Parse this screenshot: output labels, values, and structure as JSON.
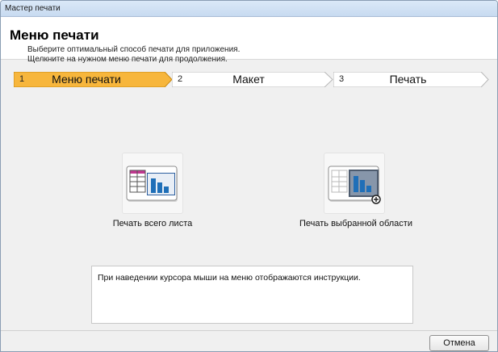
{
  "window": {
    "title": "Мастер печати"
  },
  "header": {
    "title": "Меню печати",
    "subtitle_line1": "Выберите оптимальный способ печати для приложения.",
    "subtitle_line2": "Щелкните на нужном меню печати для продолжения."
  },
  "steps": [
    {
      "number": "1",
      "label": "Меню печати",
      "active": true
    },
    {
      "number": "2",
      "label": "Макет",
      "active": false
    },
    {
      "number": "3",
      "label": "Печать",
      "active": false
    }
  ],
  "options": [
    {
      "label": "Печать всего листа",
      "icon": "sheet-with-chart-icon"
    },
    {
      "label": "Печать выбранной области",
      "icon": "selected-area-chart-icon"
    }
  ],
  "info_text": "При наведении курсора мыши на меню отображаются инструкции.",
  "buttons": {
    "cancel": "Отмена"
  },
  "colors": {
    "active_step": "#f7b63c",
    "inactive_step": "#ffffff",
    "step_border": "#b7b7b7"
  }
}
